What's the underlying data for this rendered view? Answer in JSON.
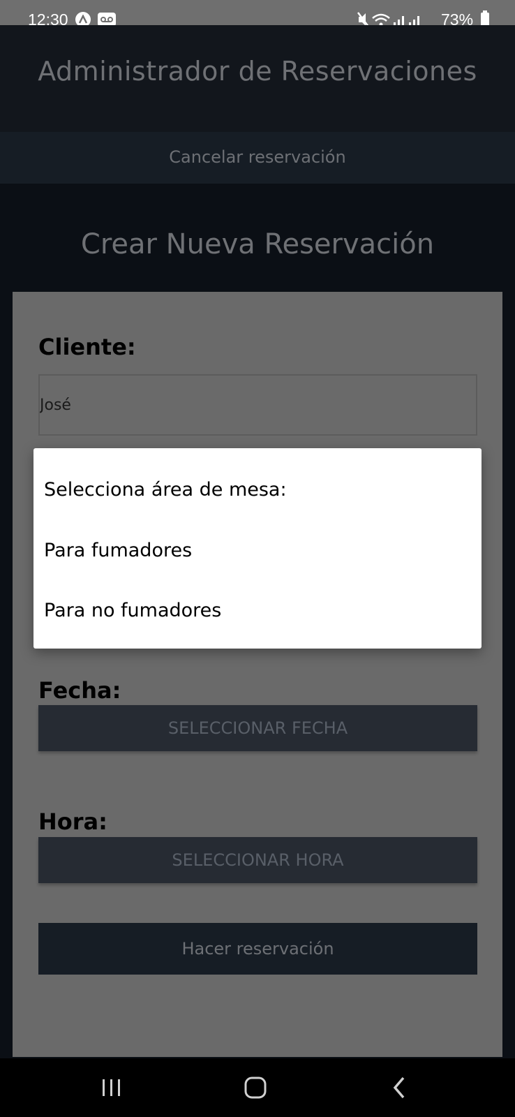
{
  "status_bar": {
    "time": "12:30",
    "battery": "73%",
    "icons": [
      "n-app-icon",
      "voicemail-icon",
      "mute-icon",
      "wifi-icon",
      "signal-icon",
      "signal-icon",
      "battery-icon"
    ]
  },
  "header": {
    "title": "Administrador de Reservaciones"
  },
  "nav": {
    "cancel_link": "Cancelar reservación"
  },
  "main": {
    "section_title": "Crear Nueva Reservación",
    "client_label": "Cliente:",
    "client_value": "José",
    "date_label": "Fecha:",
    "date_button": "SELECCIONAR FECHA",
    "time_label": "Hora:",
    "time_button": "SELECCIONAR HORA",
    "submit_button": "Hacer reservación"
  },
  "dialog": {
    "title": "Selecciona área de mesa:",
    "options": [
      "Para fumadores",
      "Para no fumadores"
    ]
  },
  "system_nav": {
    "buttons": [
      "recent-apps-icon",
      "home-icon",
      "back-icon"
    ]
  },
  "colors": {
    "header_bg": "#12161c",
    "card_bg": "#6a6a6a",
    "button_bg": "#262b33",
    "dialog_bg": "#ffffff"
  }
}
